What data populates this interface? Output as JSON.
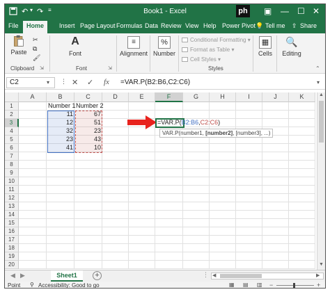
{
  "window": {
    "doc_title": "Book1 - Excel",
    "logo_text": "ph"
  },
  "ribbon_tabs": [
    "File",
    "Home",
    "Insert",
    "Page Layout",
    "Formulas",
    "Data",
    "Review",
    "View",
    "Help",
    "Power Pivot",
    "Tell me",
    "Share"
  ],
  "ribbon": {
    "paste_label": "Paste",
    "clipboard_group": "Clipboard",
    "font_button": "Font",
    "font_group": "Font",
    "alignment_button": "Alignment",
    "number_button": "Number",
    "number_symbol": "%",
    "conditional_formatting": "Conditional Formatting",
    "format_as_table": "Format as Table",
    "cell_styles": "Cell Styles",
    "styles_group": "Styles",
    "cells_button": "Cells",
    "editing_button": "Editing"
  },
  "formula_bar": {
    "name_box": "C2",
    "fx_symbol": "fx",
    "formula": "=VAR.P(B2:B6,C2:C6)"
  },
  "grid": {
    "columns": [
      "A",
      "B",
      "C",
      "D",
      "E",
      "F",
      "G",
      "H",
      "I",
      "J",
      "K"
    ],
    "rows": [
      "1",
      "2",
      "3",
      "4",
      "5",
      "6",
      "7",
      "8",
      "9",
      "10",
      "11",
      "12",
      "13",
      "14",
      "15",
      "16",
      "17",
      "18",
      "19",
      "20"
    ],
    "headers": {
      "B1": "Number 1",
      "C1": "Number 2"
    },
    "values_b": [
      "11",
      "12",
      "32",
      "23",
      "41"
    ],
    "values_c": [
      "67",
      "51",
      "23",
      "43",
      "10"
    ],
    "active_cell_formula": {
      "prefix": "=VAR.P(",
      "arg1": "B2:B6",
      "comma": ",",
      "arg2": "C2:C6",
      "suffix": ")"
    },
    "tooltip": {
      "start": "VAR.P(number1, ",
      "bold": "[number2]",
      "end": ", [number3], ...)"
    },
    "range_b_color": "#4472c4",
    "range_c_color": "#c0504d",
    "arrow_color": "#e8231e"
  },
  "sheets": {
    "active": "Sheet1",
    "add_icon": "+"
  },
  "status_bar": {
    "mode": "Point",
    "accessibility": "Accessibility: Good to go"
  }
}
